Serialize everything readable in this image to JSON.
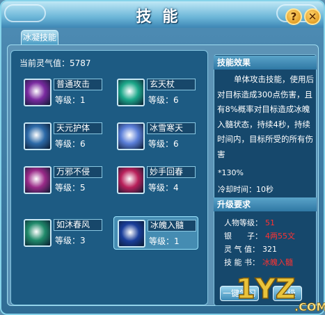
{
  "window": {
    "title": "技能",
    "help_label": "?",
    "close_label": "✕"
  },
  "tabs": [
    {
      "label": "冰凝技能"
    }
  ],
  "spirit": {
    "label": "当前灵气值：",
    "value": "5787"
  },
  "skills": [
    {
      "name": "普通攻击",
      "level_label": "等级：",
      "level": "1",
      "icon": "sword-icon",
      "color": "#7a2aa0"
    },
    {
      "name": "玄天杖",
      "level_label": "等级：",
      "level": "6",
      "icon": "staff-icon",
      "color": "#1ca88a"
    },
    {
      "name": "天元护体",
      "level_label": "等级：",
      "level": "6",
      "icon": "guardian-icon",
      "color": "#2c6aa8"
    },
    {
      "name": "冰雪寒天",
      "level_label": "等级：",
      "level": "6",
      "icon": "ice-icon",
      "color": "#5a7ed8"
    },
    {
      "name": "万邪不侵",
      "level_label": "等级：",
      "level": "5",
      "icon": "aura-icon",
      "color": "#9a2a88"
    },
    {
      "name": "妙手回春",
      "level_label": "等级：",
      "level": "4",
      "icon": "heal-icon",
      "color": "#b8205a"
    },
    {
      "name": "如沐春风",
      "level_label": "等级：",
      "level": "3",
      "icon": "wind-icon",
      "color": "#208a6a"
    },
    {
      "name": "冰魄入髓",
      "level_label": "等级：",
      "level": "1",
      "icon": "frost-orb-icon",
      "color": "#1a3e9a",
      "selected": true
    }
  ],
  "effect": {
    "heading": "技能效果",
    "text": "单体攻击技能，使用后对目标造成300点伤害，且有8%概率对目标造成冰魄入髓状态，持续4秒，持续时间内，目标所受的所有伤害",
    "multiplier": "*130%",
    "cooldown": "冷却时间：10秒"
  },
  "requirements": {
    "heading": "升级要求",
    "rows": [
      {
        "label": "人物等级：",
        "value": "51",
        "highlight": true
      },
      {
        "label": "银　　子：",
        "value": "4两55文",
        "highlight": true
      },
      {
        "label": "灵 气 值：",
        "value": "321",
        "highlight": false
      },
      {
        "label": "技 能 书：",
        "value": "冰魄入髓",
        "highlight": true
      }
    ]
  },
  "buttons": {
    "learn_all": "一键学习",
    "upgrade": "升级"
  },
  "watermark": {
    "text": "1YZ",
    "suffix": ".COM"
  },
  "colors": {
    "accent": "#86d3ea",
    "panel": "#1d5b83",
    "highlight": "#ff3232"
  }
}
